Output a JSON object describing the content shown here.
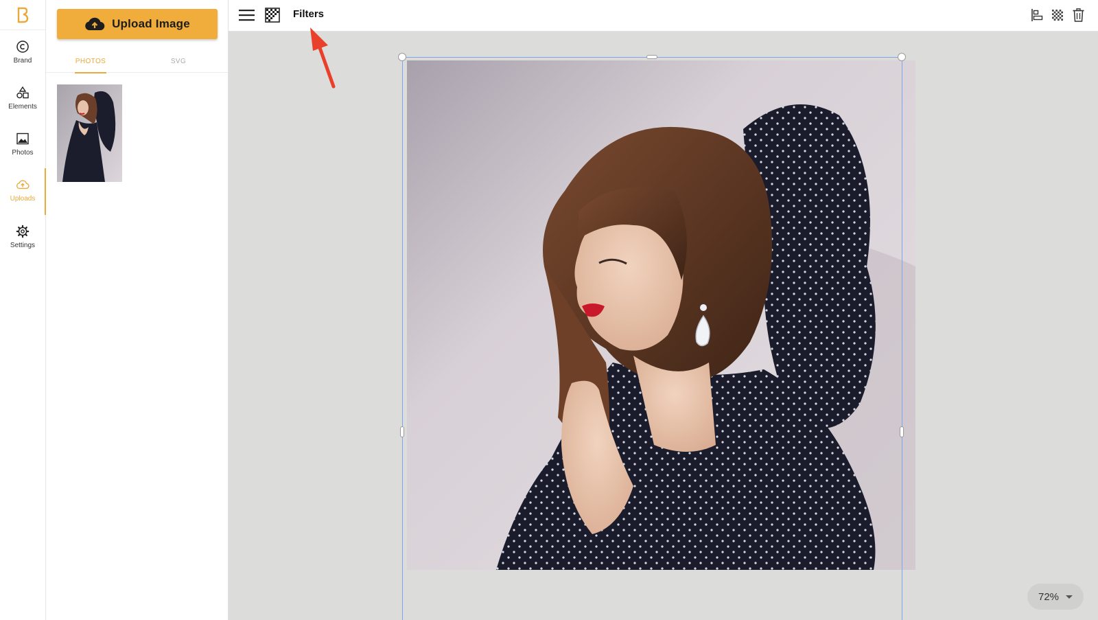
{
  "colors": {
    "accent": "#e9a93b",
    "upload_button": "#f0ad3c",
    "canvas_background": "#dcdcdb",
    "selection": "#7aa6ec",
    "annotation_arrow": "#e8402b"
  },
  "rail": {
    "logo_icon": "brand-logo-icon",
    "items": [
      {
        "label": "Brand",
        "icon": "copyright-icon"
      },
      {
        "label": "Elements",
        "icon": "shapes-icon"
      },
      {
        "label": "Photos",
        "icon": "image-icon"
      },
      {
        "label": "Uploads",
        "icon": "cloud-upload-icon",
        "active": true
      },
      {
        "label": "Settings",
        "icon": "gear-icon"
      }
    ]
  },
  "panel": {
    "upload_button_label": "Upload Image",
    "tabs": [
      {
        "label": "PHOTOS",
        "active": true
      },
      {
        "label": "SVG",
        "active": false
      }
    ]
  },
  "toolbar": {
    "filters_label": "Filters",
    "left_icons": [
      "hamburger-menu-icon",
      "checkerboard-filter-icon"
    ],
    "right_icons": [
      "align-left-icon",
      "transparency-icon",
      "trash-icon"
    ]
  },
  "canvas": {
    "zoom_label": "72%"
  }
}
